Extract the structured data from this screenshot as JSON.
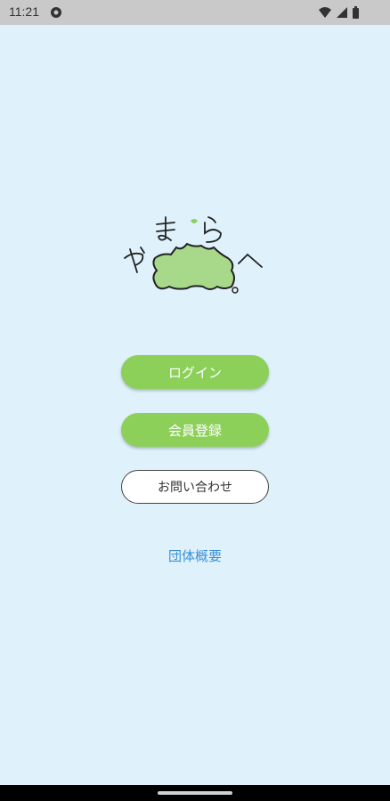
{
  "status_bar": {
    "time": "11:21",
    "icons": [
      "notification-icon",
      "wifi-icon",
      "signal-icon",
      "battery-icon"
    ]
  },
  "logo": {
    "text": "やまらへ",
    "accent_color": "#8cd05a",
    "map_color": "#a8d88a"
  },
  "buttons": {
    "login": "ログイン",
    "register": "会員登録",
    "contact": "お問い合わせ"
  },
  "links": {
    "about": "団体概要"
  },
  "colors": {
    "background": "#dff2fc",
    "primary_button": "#8cd05a",
    "link": "#3a8fd6"
  }
}
